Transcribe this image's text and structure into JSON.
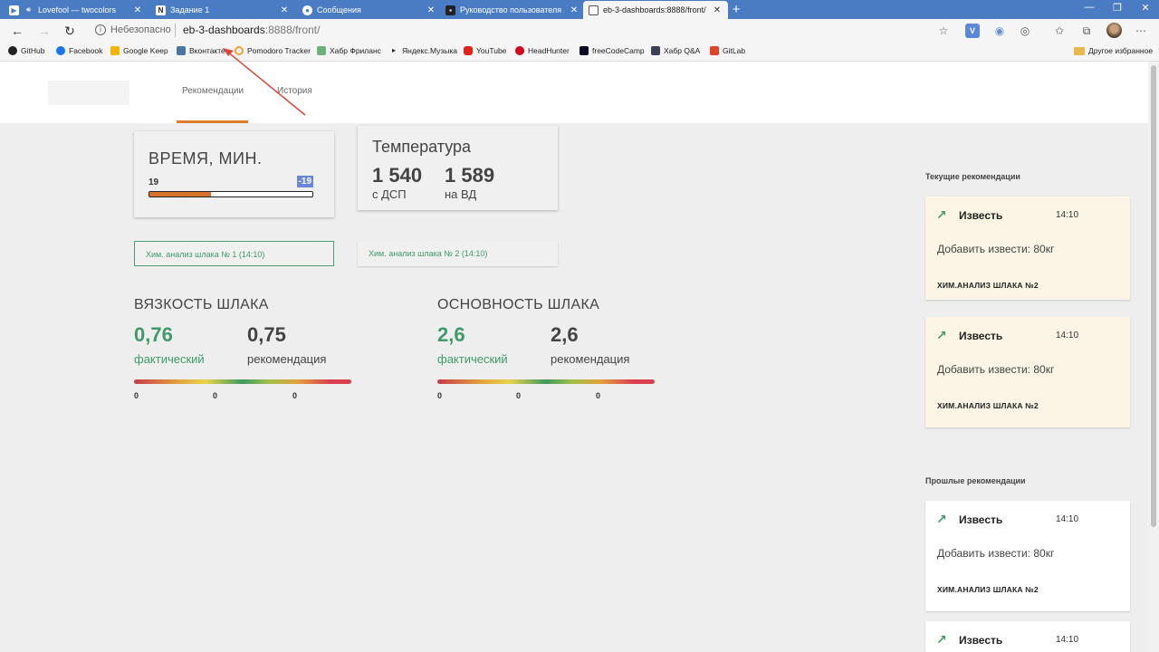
{
  "browser": {
    "tabs": [
      {
        "label": "Lovefool — twocolors",
        "icon": "play-icon",
        "color": "#ffffff",
        "active": false
      },
      {
        "label": "Задание 1",
        "icon": "notion-icon",
        "color": "#ffffff",
        "active": false
      },
      {
        "label": "Сообщения",
        "icon": "chat-icon",
        "color": "#ffffff",
        "active": false
      },
      {
        "label": "Руководство пользователя / Ор",
        "icon": "terminal-icon",
        "color": "#ffffff",
        "active": false
      },
      {
        "label": "eb-3-dashboards:8888/front/",
        "icon": "page-icon",
        "color": "#ffffff",
        "active": true
      }
    ],
    "new_tab": "+",
    "address": {
      "security_label": "Небезопасно",
      "host": "eb-3-dashboards",
      "rest": ":8888/front/"
    },
    "bookmarks": [
      {
        "label": "GitHub",
        "color": "#222222"
      },
      {
        "label": "Facebook",
        "color": "#1877f2"
      },
      {
        "label": "Google Keep",
        "color": "#f4b400"
      },
      {
        "label": "Вконтакте",
        "color": "#4a76a8"
      },
      {
        "label": "Pomodoro Tracker",
        "color": "#e8a23a"
      },
      {
        "label": "Хабр Фриланс",
        "color": "#6bb37a"
      },
      {
        "label": "Яндекс.Музыка",
        "color": "#333333"
      },
      {
        "label": "YouTube",
        "color": "#e62117"
      },
      {
        "label": "HeadHunter",
        "color": "#d6001c"
      },
      {
        "label": "freeCodeCamp",
        "color": "#0a0a23"
      },
      {
        "label": "Хабр Q&A",
        "color": "#3b3f58"
      },
      {
        "label": "GitLab",
        "color": "#e24329"
      }
    ],
    "other_bookmarks": "Другое избранное"
  },
  "nav": {
    "tab_recommendations": "Рекомендации",
    "tab_history": "История"
  },
  "time_card": {
    "title": "ВРЕМЯ, МИН.",
    "left_value": "19",
    "right_value": "-19",
    "progress_fraction": 0.38
  },
  "temperature_card": {
    "title": "Температура",
    "dsp_value": "1 540",
    "dsp_label": "с ДСП",
    "vd_value": "1 589",
    "vd_label": "на ВД"
  },
  "analyses": [
    {
      "label": "Хим. анализ шлака № 1 (14:10)",
      "selected": true
    },
    {
      "label": "Хим. анализ шлака № 2 (14:10)",
      "selected": false
    }
  ],
  "viscosity": {
    "title": "ВЯЗКОСТЬ ШЛАКА",
    "actual_value": "0,76",
    "actual_label": "фактический",
    "recommended_value": "0,75",
    "recommended_label": "рекомендация",
    "ticks": [
      "0",
      "0",
      "0"
    ]
  },
  "basicity": {
    "title": "ОСНОВНОСТЬ ШЛАКА",
    "actual_value": "2,6",
    "actual_label": "фактический",
    "recommended_value": "2,6",
    "recommended_label": "рекомендация",
    "ticks": [
      "0",
      "0",
      "0"
    ]
  },
  "current_recommendations": {
    "heading": "Текущие рекомендации",
    "items": [
      {
        "name": "Известь",
        "time": "14:10",
        "description": "Добавить извести: 80кг",
        "source": "ХИМ.АНАЛИЗ ШЛАКА №2"
      },
      {
        "name": "Известь",
        "time": "14:10",
        "description": "Добавить извести: 80кг",
        "source": "ХИМ.АНАЛИЗ ШЛАКА №2"
      }
    ]
  },
  "past_recommendations": {
    "heading": "Прошлые рекомендации",
    "items": [
      {
        "name": "Известь",
        "time": "14:10",
        "description": "Добавить извести: 80кг",
        "source": "ХИМ.АНАЛИЗ ШЛАКА №2"
      },
      {
        "name": "Известь",
        "time": "14:10",
        "description": "",
        "source": ""
      }
    ]
  },
  "colors": {
    "accent_orange": "#e07b2a",
    "green": "#3f9a68",
    "tabbar": "#4a7cc4",
    "current_card_bg": "#fcf5e6"
  }
}
